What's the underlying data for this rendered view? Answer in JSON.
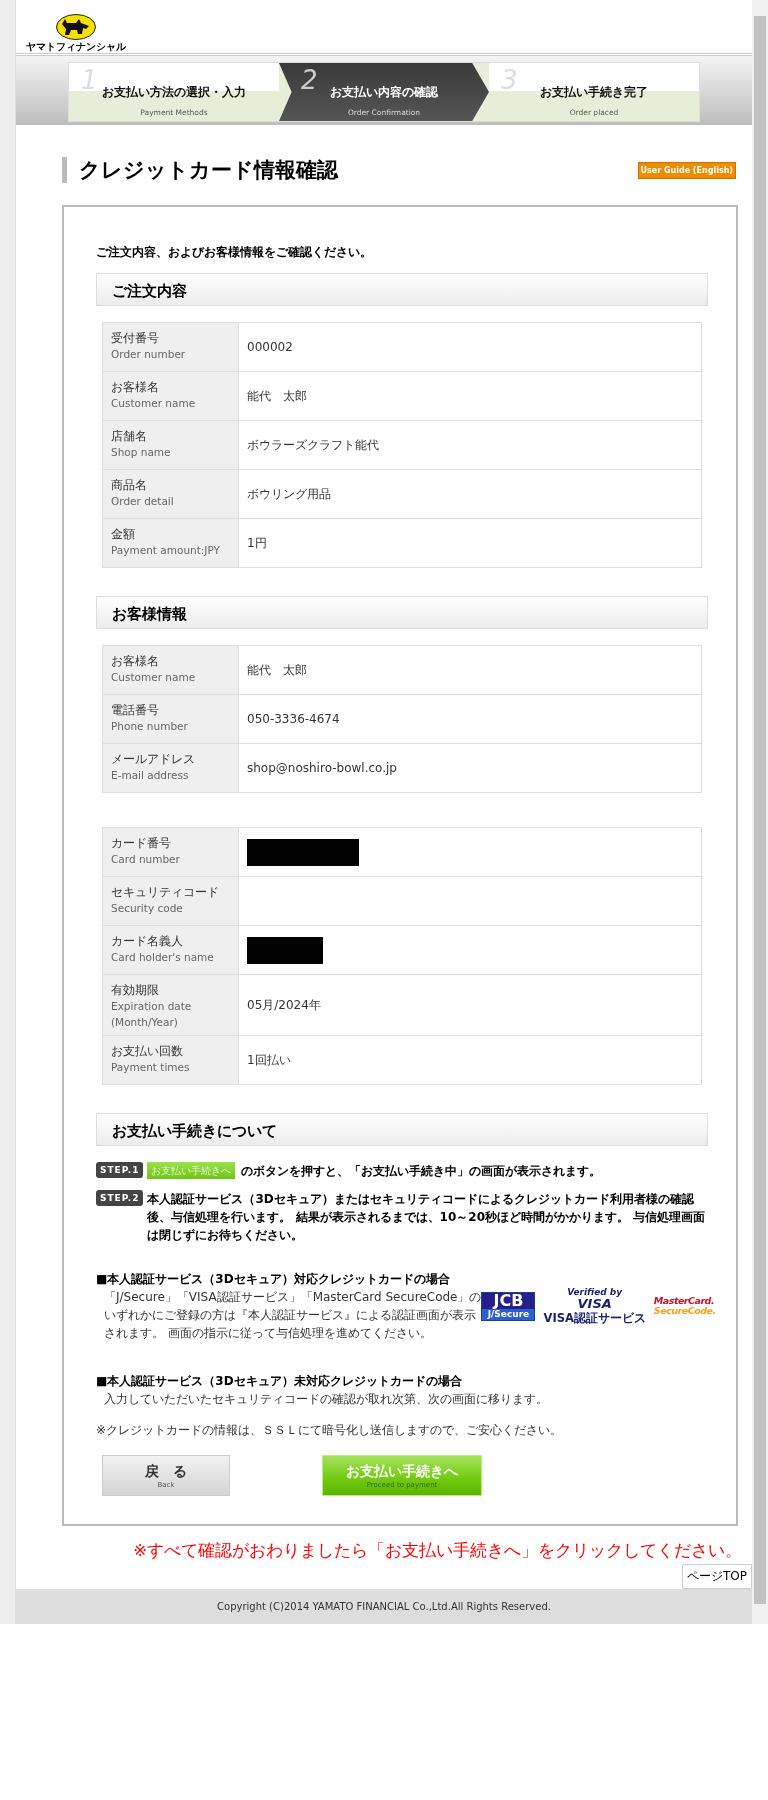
{
  "logo": {
    "caption": "ヤマトフィナンシャル"
  },
  "steps": [
    {
      "number": "1",
      "label": "お支払い方法の選択・入力",
      "sublabel": "Payment Methods",
      "selected": false
    },
    {
      "number": "2",
      "label": "お支払い内容の確認",
      "sublabel": "Order Confirmation",
      "selected": true
    },
    {
      "number": "3",
      "label": "お支払い手続き完了",
      "sublabel": "Order placed",
      "selected": false
    }
  ],
  "page_title": "クレジットカード情報確認",
  "user_guide_button": "User Guide (English)",
  "intro": "ご注文内容、およびお客様情報をご確認ください。",
  "sections": [
    {
      "heading": "ご注文内容",
      "tables": [
        [
          {
            "label": "受付番号",
            "label_en": "Order number",
            "value": "000002",
            "redacted": false
          },
          {
            "label": "お客様名",
            "label_en": "Customer name",
            "value": "能代　太郎",
            "redacted": false
          },
          {
            "label": "店舗名",
            "label_en": "Shop name",
            "value": "ボウラーズクラフト能代",
            "redacted": false
          },
          {
            "label": "商品名",
            "label_en": "Order detail",
            "value": "ボウリング用品",
            "redacted": false
          },
          {
            "label": "金額",
            "label_en": "Payment amount:JPY",
            "value": "1円",
            "redacted": false
          }
        ]
      ]
    },
    {
      "heading": "お客様情報",
      "tables": [
        [
          {
            "label": "お客様名",
            "label_en": "Customer name",
            "value": "能代　太郎",
            "redacted": false
          },
          {
            "label": "電話番号",
            "label_en": "Phone number",
            "value": "050-3336-4674",
            "redacted": false
          },
          {
            "label": "メールアドレス",
            "label_en": "E-mail address",
            "value": "shop@noshiro-bowl.co.jp",
            "redacted": false
          }
        ],
        [
          {
            "label": "カード番号",
            "label_en": "Card number",
            "redacted": true
          },
          {
            "label": "セキュリティコード",
            "label_en": "Security code",
            "redacted": false
          },
          {
            "label": "カード名義人",
            "label_en": "Card holder's name",
            "redacted": true
          },
          {
            "label": "有効期限",
            "label_en": "Expiration date (Month/Year)",
            "value": "05月/2024年",
            "redacted": false
          },
          {
            "label": "お支払い回数",
            "label_en": "Payment times",
            "value": "1回払い",
            "redacted": false
          }
        ]
      ]
    }
  ],
  "procedure": {
    "heading": "お支払い手続きについて",
    "steps": [
      {
        "badge": "STEP.1",
        "inline_button": "お支払い手続きへ",
        "text": "のボタンを押すと、「お支払い手続き中」の画面が表示されます。"
      },
      {
        "badge": "STEP.2",
        "text": "本人認証サービス（3Dセキュア）またはセキュリティコードによるクレジットカード利用者様の確認後、与信処理を行います。 結果が表示されるまでは、10～20秒ほど時間がかかります。 与信処理画面は閉じずにお待ちください。"
      }
    ],
    "notes": [
      {
        "heading": "■本人認証サービス（3Dセキュア）対応クレジットカードの場合",
        "lines": [
          "「J/Secure」「VISA認証サービス」「MasterCard SecureCode」の",
          "いずれかにご登録の方は『本人認証サービス』による認証画面が表示",
          "されます。 画面の指示に従って与信処理を進めてください。"
        ],
        "logos": [
          {
            "kind": "jcb",
            "lines": [
              "JCB",
              "J/Secure"
            ]
          },
          {
            "kind": "visa",
            "lines": [
              "Verified by",
              "VISA",
              "VISA認証サービス"
            ]
          },
          {
            "kind": "mastercard",
            "lines": [
              "MasterCard.",
              "SecureCode."
            ]
          }
        ]
      },
      {
        "heading": "■本人認証サービス（3Dセキュア）未対応クレジットカードの場合",
        "lines": [
          "入力していただいたセキュリティコードの確認が取れ次第、次の画面に移ります。"
        ]
      }
    ],
    "ssl_note": "※クレジットカードの情報は、ＳＳＬにて暗号化し送信しますので、ご安心ください。"
  },
  "buttons": [
    {
      "kind": "back",
      "label": "戻　る",
      "sublabel": "Back"
    },
    {
      "kind": "proceed",
      "label": "お支払い手続きへ",
      "sublabel": "Proceed to payment"
    }
  ],
  "notice": "※すべて確認がおわりましたら「お支払い手続きへ」をクリックしてください。",
  "page_top": "ページTOP",
  "footer": "Copyright (C)2014 YAMATO FINANCIAL Co.,Ltd.All Rights Reserved."
}
